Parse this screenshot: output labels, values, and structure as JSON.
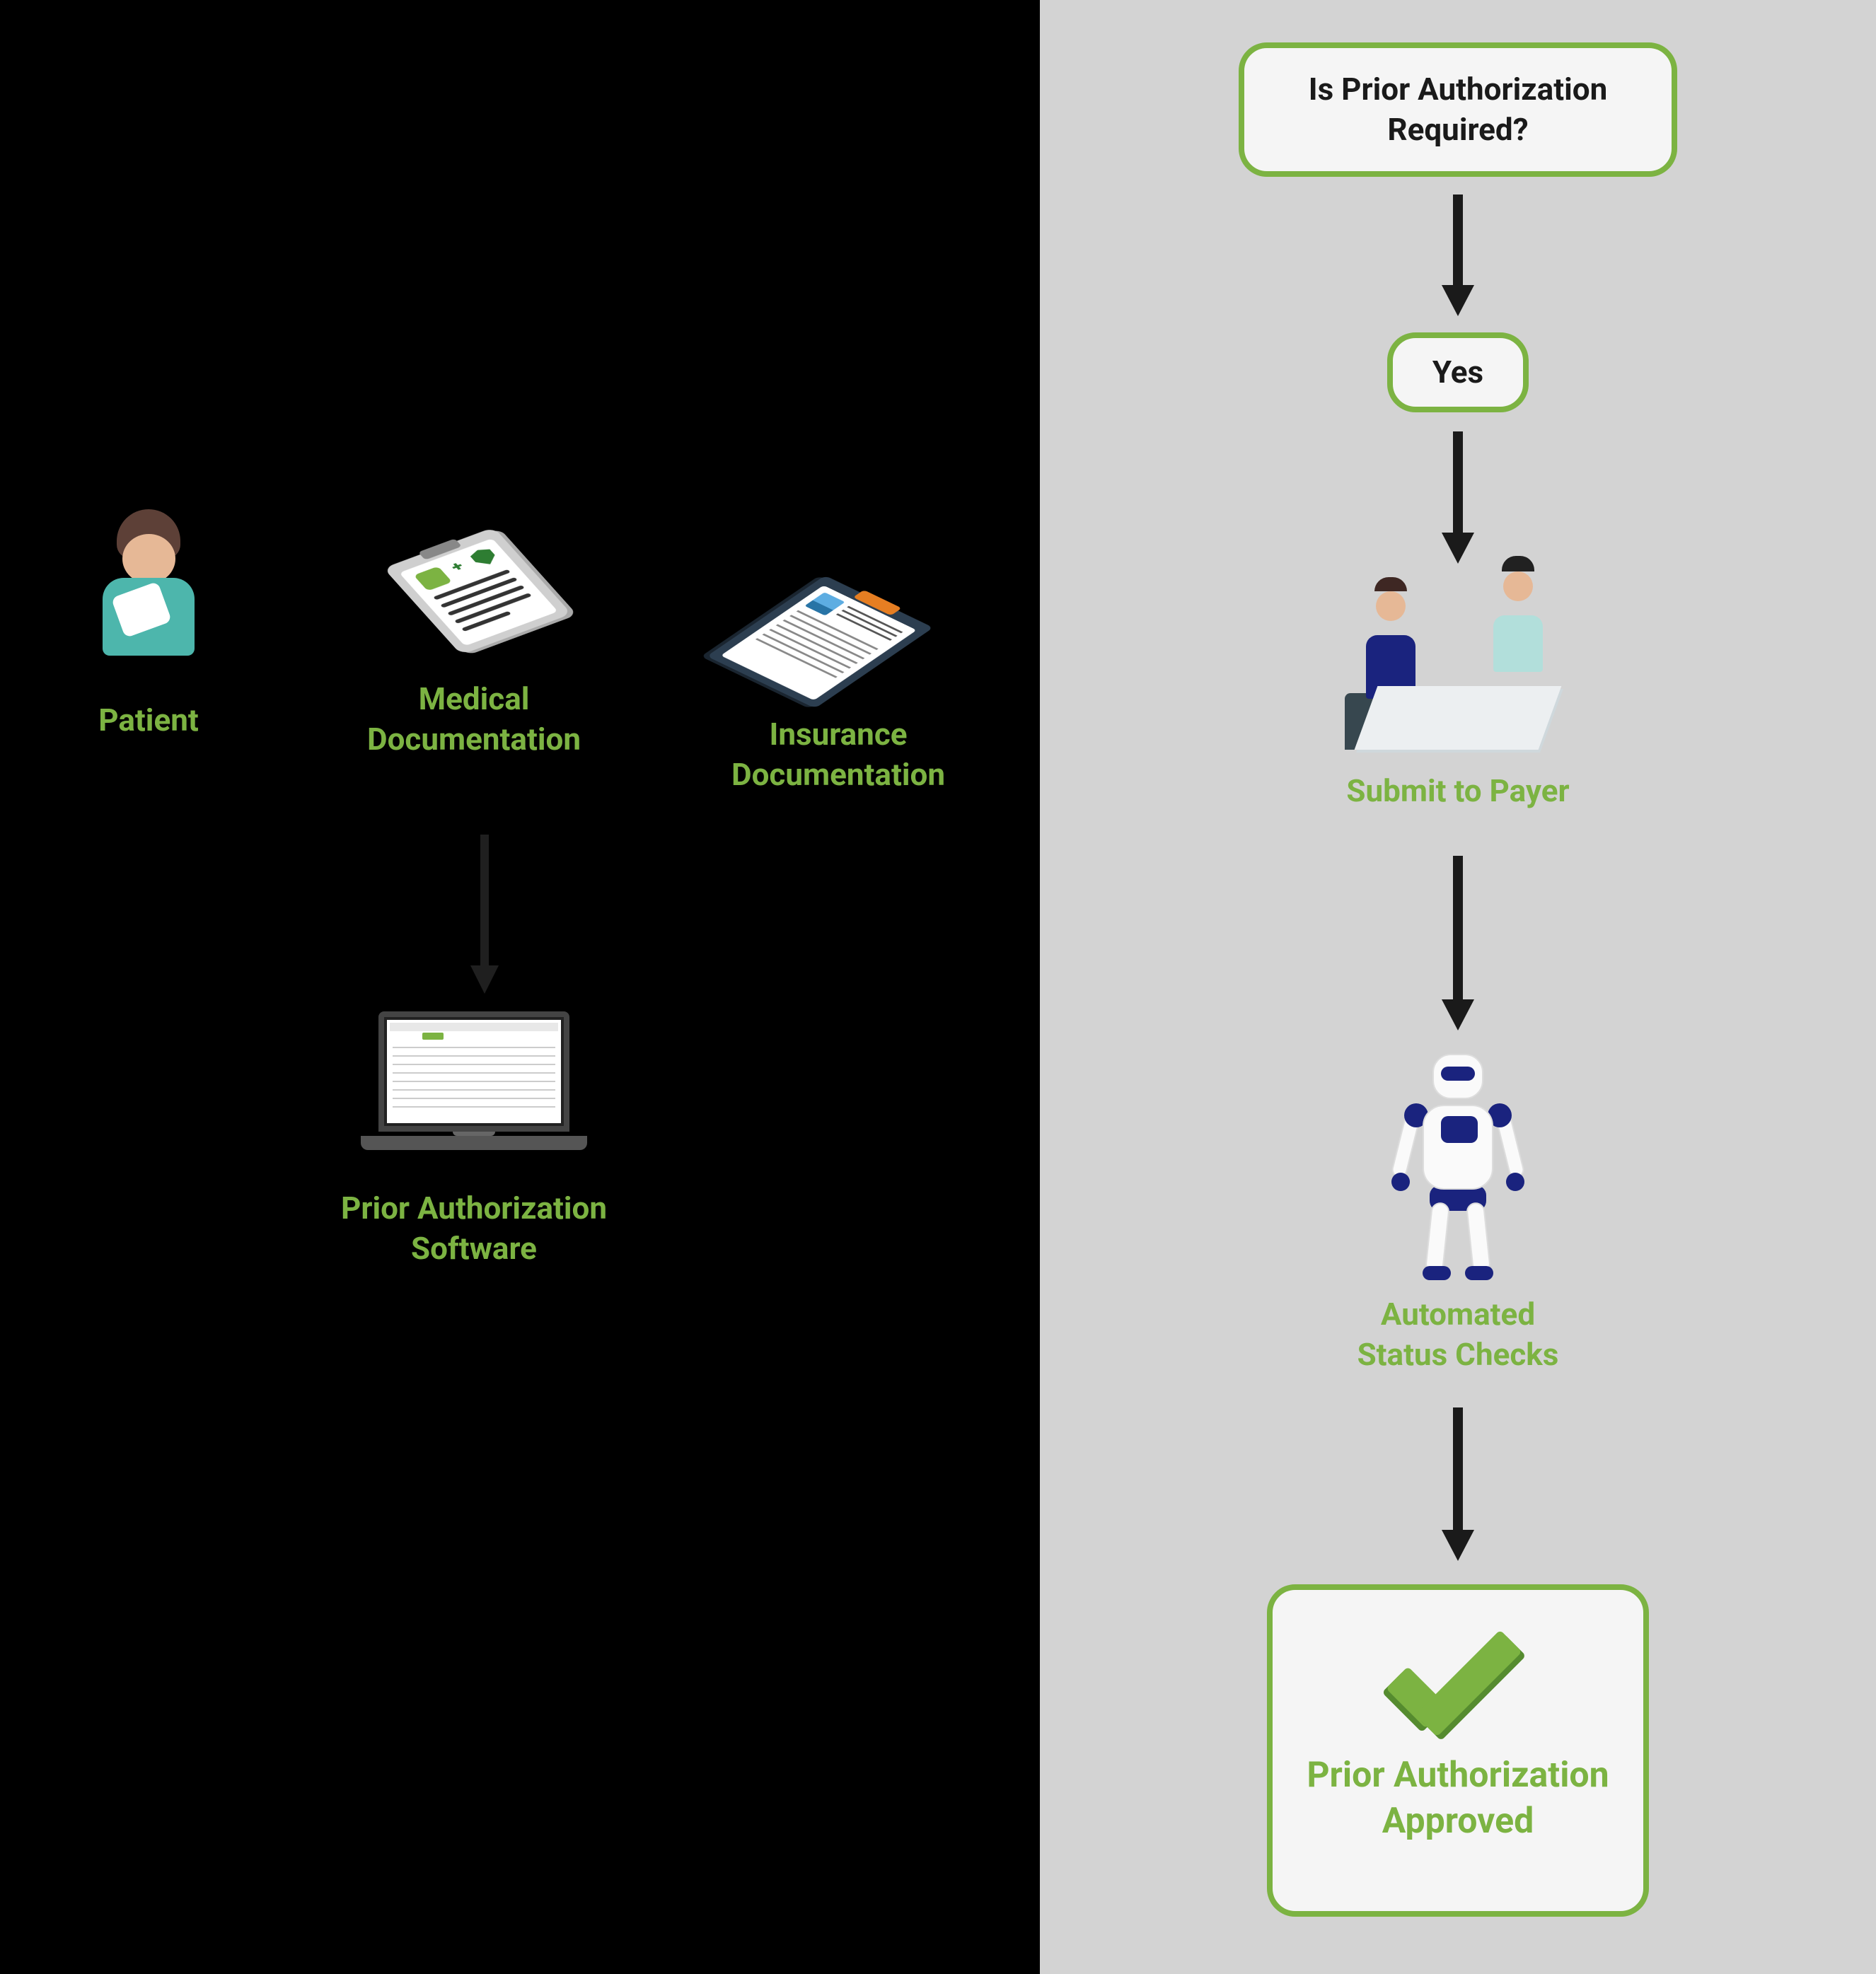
{
  "left": {
    "patient": {
      "label": "Patient"
    },
    "medical_doc": {
      "label": "Medical\nDocumentation"
    },
    "insurance_doc": {
      "label": "Insurance\nDocumentation"
    },
    "software": {
      "label": "Prior Authorization\nSoftware"
    }
  },
  "right": {
    "question": {
      "label": "Is Prior Authorization\nRequired?"
    },
    "yes": {
      "label": "Yes"
    },
    "submit": {
      "label": "Submit to Payer"
    },
    "status": {
      "label": "Automated\nStatus Checks"
    },
    "approved": {
      "label": "Prior Authorization\nApproved"
    }
  }
}
